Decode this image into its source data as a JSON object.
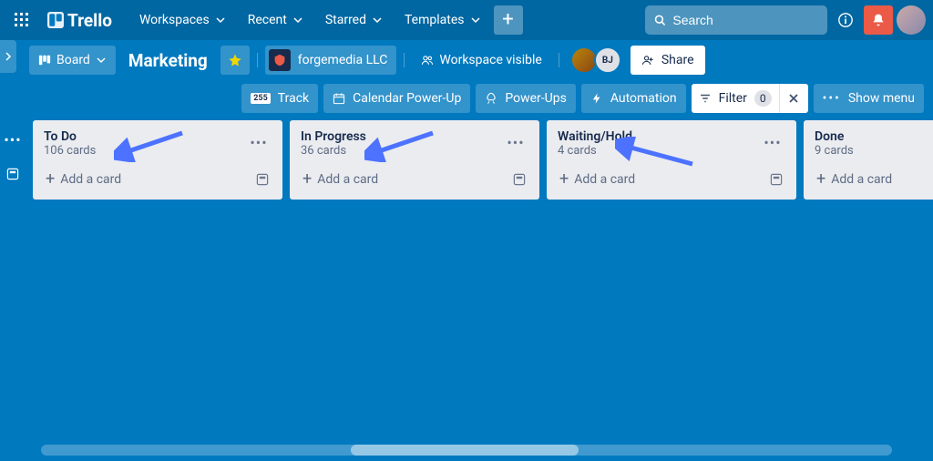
{
  "nav": {
    "logo_text": "Trello",
    "items": [
      "Workspaces",
      "Recent",
      "Starred",
      "Templates"
    ],
    "search_placeholder": "Search"
  },
  "board": {
    "view_label": "Board",
    "title": "Marketing",
    "org_name": "forgemedia LLC",
    "visibility_label": "Workspace visible",
    "share_label": "Share",
    "member_initials": [
      "",
      "BJ"
    ]
  },
  "subheader": {
    "track": "Track",
    "calendar": "Calendar Power-Up",
    "powerups": "Power-Ups",
    "automation": "Automation",
    "filter_label": "Filter",
    "filter_count": "0",
    "show_menu": "Show menu"
  },
  "lists": [
    {
      "title": "To Do",
      "count": "106 cards",
      "add": "Add a card"
    },
    {
      "title": "In Progress",
      "count": "36 cards",
      "add": "Add a card"
    },
    {
      "title": "Waiting/Hold",
      "count": "4 cards",
      "add": "Add a card"
    },
    {
      "title": "Done",
      "count": "9 cards",
      "add": "Add a card"
    }
  ]
}
